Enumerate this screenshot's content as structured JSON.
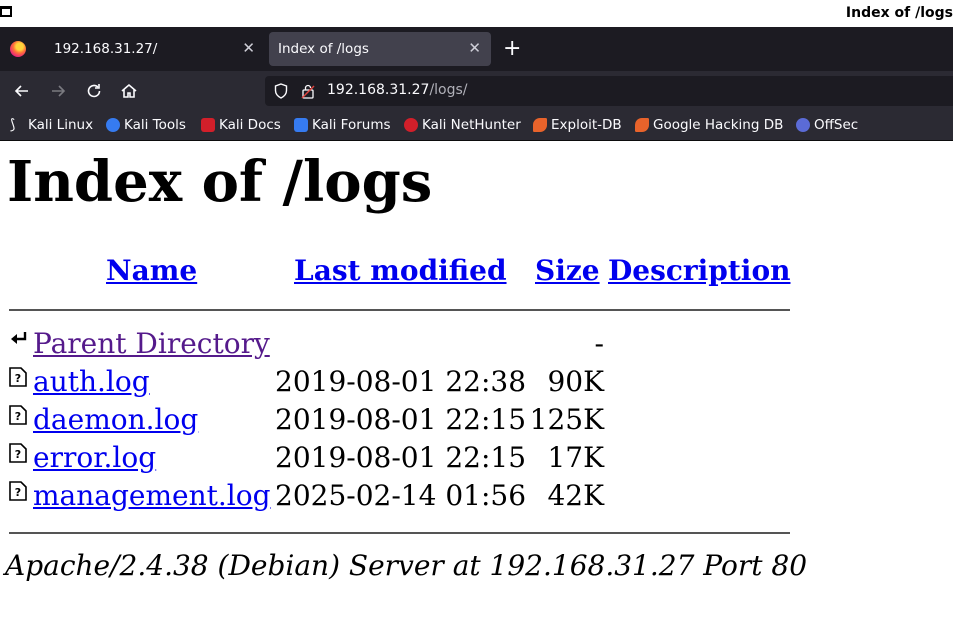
{
  "window": {
    "title": "Index of /logs"
  },
  "tabs": [
    {
      "label": "192.168.31.27/",
      "active": false
    },
    {
      "label": "Index of /logs",
      "active": true
    }
  ],
  "nav": {
    "url_host": "192.168.31.27",
    "url_path": "/logs/"
  },
  "bookmarks": [
    {
      "label": "Kali Linux",
      "icon": "kali-dragon-icon",
      "color": "#367bf0"
    },
    {
      "label": "Kali Tools",
      "icon": "kali-tools-icon",
      "color": "#367bf0"
    },
    {
      "label": "Kali Docs",
      "icon": "kali-docs-icon",
      "color": "#d21f2a"
    },
    {
      "label": "Kali Forums",
      "icon": "kali-forums-icon",
      "color": "#367bf0"
    },
    {
      "label": "Kali NetHunter",
      "icon": "kali-nethunter-icon",
      "color": "#d21f2a"
    },
    {
      "label": "Exploit-DB",
      "icon": "exploit-db-icon",
      "color": "#e8632b"
    },
    {
      "label": "Google Hacking DB",
      "icon": "ghdb-icon",
      "color": "#e8632b"
    },
    {
      "label": "OffSec",
      "icon": "offsec-icon",
      "color": "#5b6bd6"
    }
  ],
  "page": {
    "heading": "Index of /logs",
    "columns": {
      "name": "Name",
      "modified": "Last modified",
      "size": "Size",
      "description": "Description"
    },
    "parent": {
      "name": "Parent Directory",
      "size": "-"
    },
    "files": [
      {
        "name": "auth.log",
        "modified": "2019-08-01 22:38",
        "size": "90K"
      },
      {
        "name": "daemon.log",
        "modified": "2019-08-01 22:15",
        "size": "125K"
      },
      {
        "name": "error.log",
        "modified": "2019-08-01 22:15",
        "size": "17K"
      },
      {
        "name": "management.log",
        "modified": "2025-02-14 01:56",
        "size": "42K"
      }
    ],
    "footer": "Apache/2.4.38 (Debian) Server at 192.168.31.27 Port 80"
  }
}
